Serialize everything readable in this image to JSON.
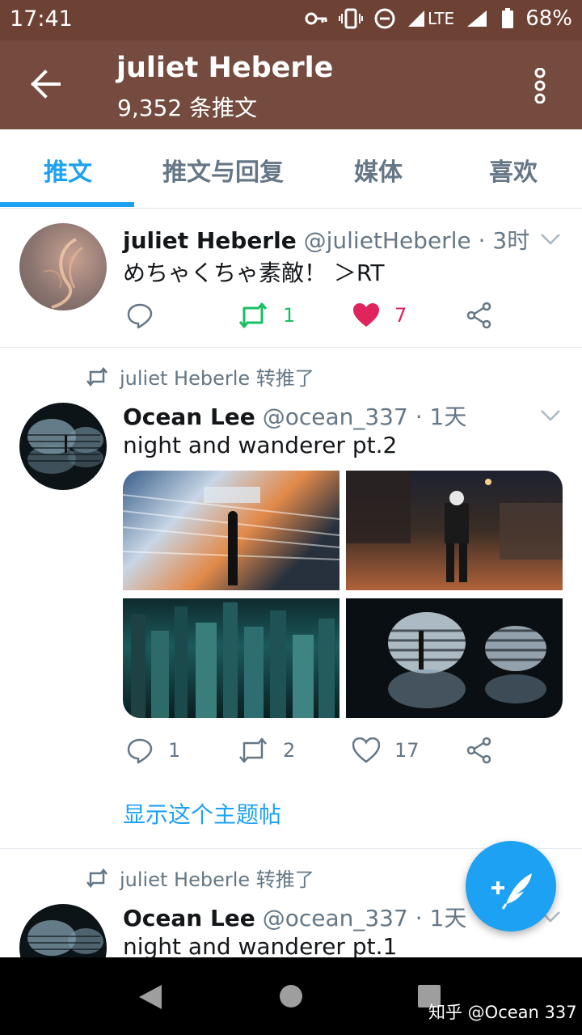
{
  "status_bar": {
    "time": "17:41",
    "network": "LTE",
    "battery": "68%"
  },
  "header": {
    "title": "juliet Heberle",
    "subtitle": "9,352 条推文"
  },
  "tabs": [
    {
      "label": "推文",
      "active": true
    },
    {
      "label": "推文与回复",
      "active": false
    },
    {
      "label": "媒体",
      "active": false
    },
    {
      "label": "喜欢",
      "active": false
    }
  ],
  "tweets": [
    {
      "name": "juliet Heberle",
      "handle": "@julietHeberle · 3时",
      "text": "めちゃくちゃ素敵！ ＞RT",
      "retweets": "1",
      "likes": "7",
      "liked": true,
      "retweeted": true
    },
    {
      "retweet_context": "juliet Heberle 转推了",
      "name": "Ocean Lee",
      "handle": "@ocean_337 · 1天",
      "text": "night and wanderer pt.2",
      "replies": "1",
      "retweets": "2",
      "likes": "17",
      "show_thread": "显示这个主题帖"
    },
    {
      "retweet_context": "juliet Heberle 转推了",
      "name": "Ocean Lee",
      "handle": "@ocean_337 · 1天",
      "text": "night and wanderer pt.1"
    }
  ],
  "watermark": "知乎 @Ocean 337",
  "colors": {
    "header_bg": "#744b3e",
    "accent": "#1da1f2",
    "retweet_green": "#17bf63",
    "like_red": "#e0245e"
  }
}
